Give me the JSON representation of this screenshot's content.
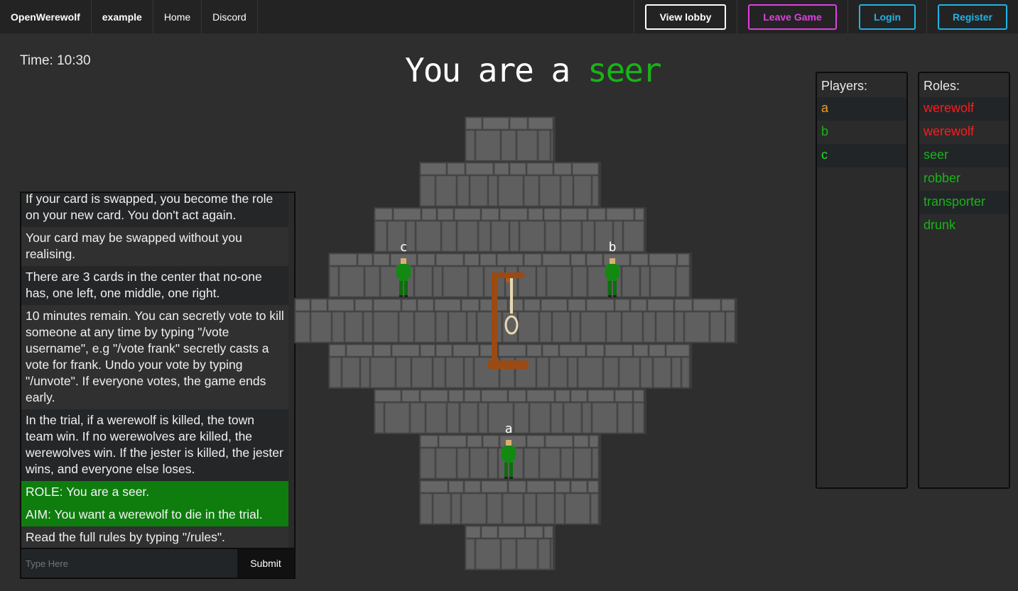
{
  "nav": {
    "brand": "OpenWerewolf",
    "game_name": "example",
    "home": "Home",
    "discord": "Discord",
    "view_lobby": "View lobby",
    "leave_game": "Leave Game",
    "login": "Login",
    "register": "Register"
  },
  "timer": "Time: 10:30",
  "title": {
    "prefix": "You are a",
    "role": "seer"
  },
  "chat": {
    "messages": [
      {
        "text": "If your card is swapped, you become the role on your new card. You don't act again.",
        "style": "dark"
      },
      {
        "text": "Your card may be swapped without you realising.",
        "style": "light"
      },
      {
        "text": "There are 3 cards in the center that no-one has, one left, one middle, one right.",
        "style": "dark"
      },
      {
        "text": "10 minutes remain. You can secretly vote to kill someone at any time by typing \"/vote username\", e.g \"/vote frank\" secretly casts a vote for frank. Undo your vote by typing \"/unvote\". If everyone votes, the game ends early.",
        "style": "light"
      },
      {
        "text": "In the trial, if a werewolf is killed, the town team win. If no werewolves are killed, the werewolves win. If the jester is killed, the jester wins, and everyone else loses.",
        "style": "dark"
      },
      {
        "text": "ROLE: You are a seer.",
        "style": "green"
      },
      {
        "text": "AIM: You want a werewolf to die in the trial.",
        "style": "green"
      },
      {
        "text": "Read the full rules by typing \"/rules\".",
        "style": "light"
      }
    ],
    "input_placeholder": "Type Here",
    "submit": "Submit"
  },
  "board": {
    "players": [
      {
        "label": "c"
      },
      {
        "label": "b"
      },
      {
        "label": "a"
      }
    ]
  },
  "players_panel": {
    "header": "Players:",
    "items": [
      {
        "name": "a",
        "color": "#f0a020"
      },
      {
        "name": "b",
        "color": "#19b319"
      },
      {
        "name": "c",
        "color": "#19e619"
      }
    ]
  },
  "roles_panel": {
    "header": "Roles:",
    "items": [
      {
        "name": "werewolf",
        "color": "#ff1a1a"
      },
      {
        "name": "werewolf",
        "color": "#ff1a1a"
      },
      {
        "name": "seer",
        "color": "#19b319"
      },
      {
        "name": "robber",
        "color": "#19b319"
      },
      {
        "name": "transporter",
        "color": "#19b319"
      },
      {
        "name": "drunk",
        "color": "#19b319"
      }
    ]
  }
}
